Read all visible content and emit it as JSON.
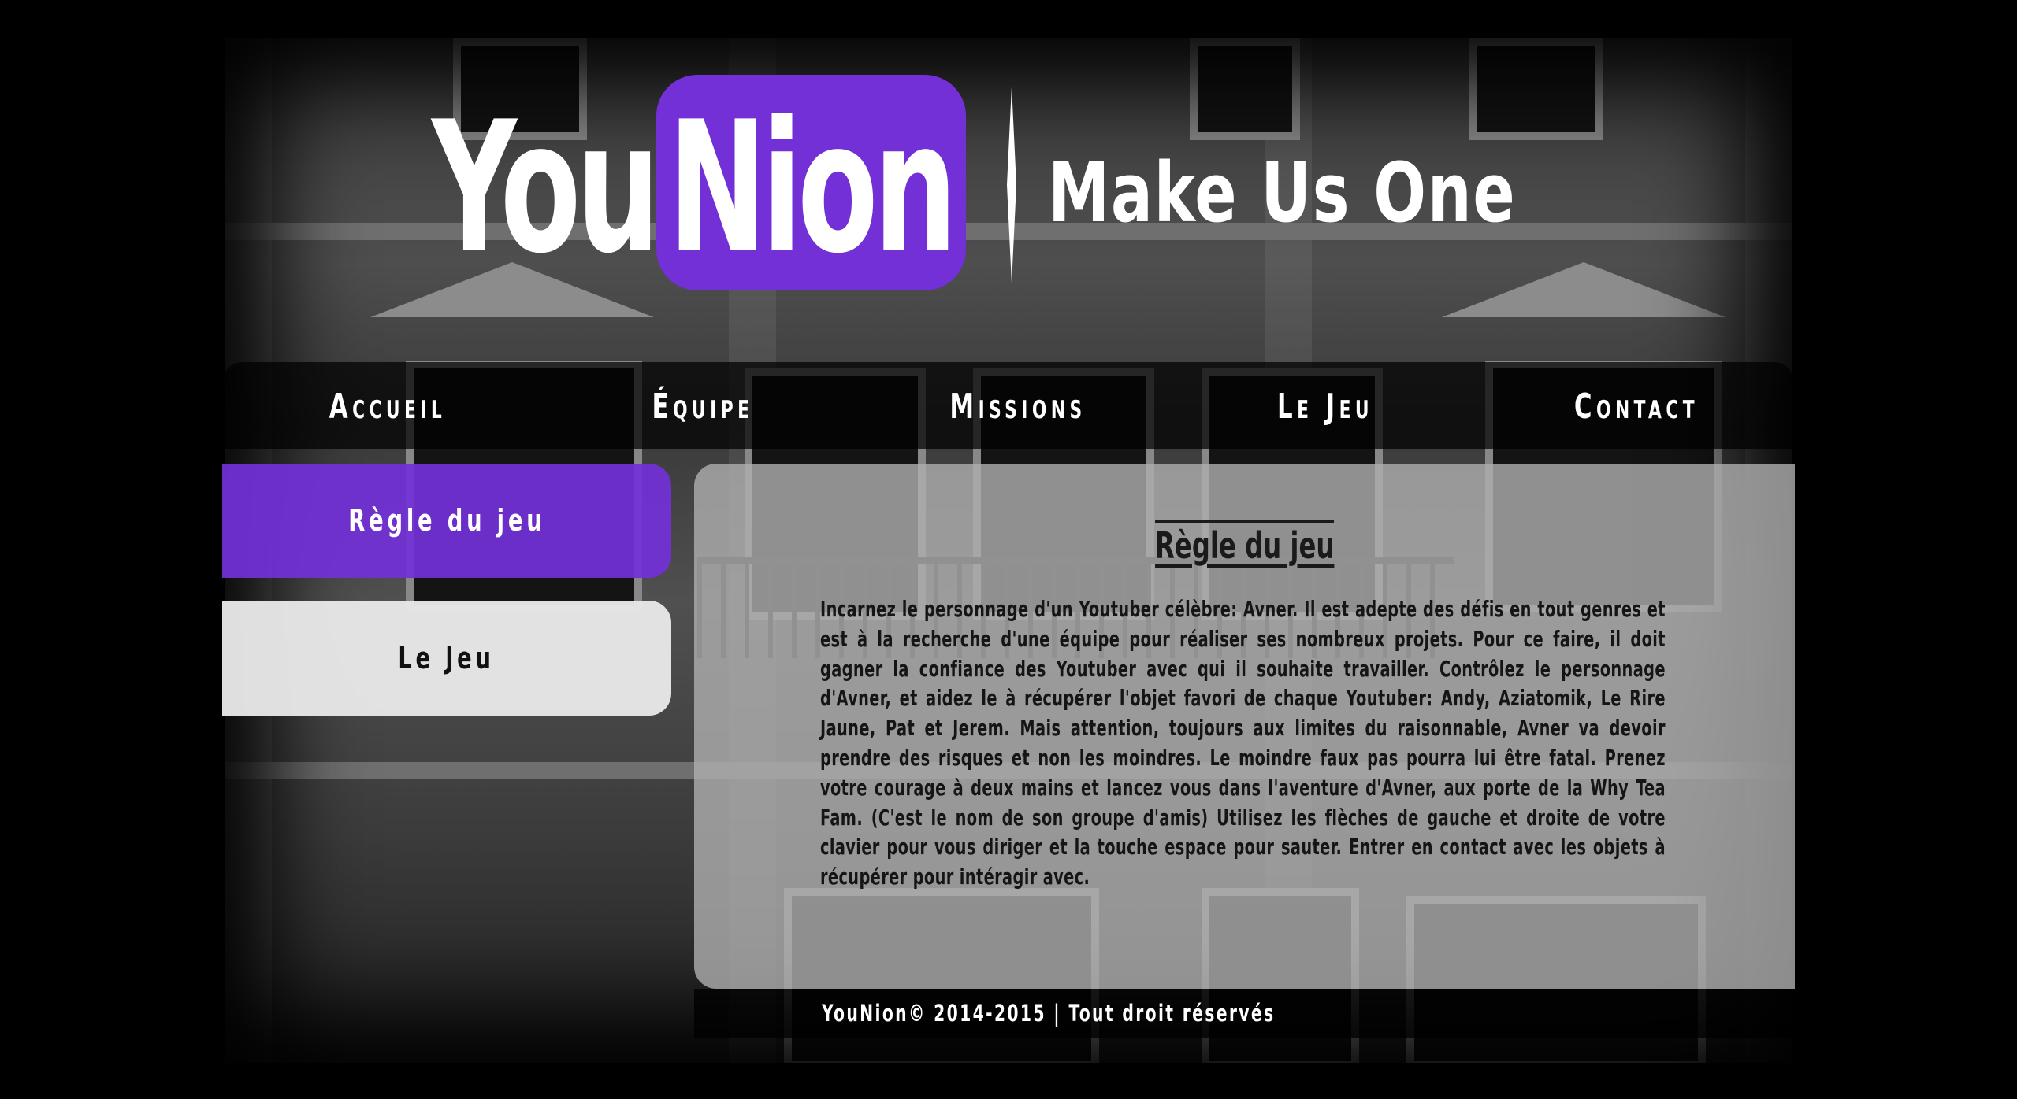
{
  "header": {
    "logo_part1": "You",
    "logo_part2": "Nion",
    "tagline": "Make Us One"
  },
  "nav": {
    "items": [
      {
        "label": "Accueil"
      },
      {
        "label": "Équipe"
      },
      {
        "label": "Missions"
      },
      {
        "label": "Le Jeu"
      },
      {
        "label": "Contact"
      }
    ]
  },
  "sidebar": {
    "items": [
      {
        "label": "Règle du jeu",
        "active": true
      },
      {
        "label": "Le Jeu",
        "active": false
      }
    ]
  },
  "content": {
    "title": "Règle du jeu",
    "body": "Incarnez le personnage d'un Youtuber célèbre: Avner. Il est adepte des défis en tout genres et est à la recherche d'une équipe pour réaliser ses nombreux projets. Pour ce faire, il doit gagner la confiance des Youtuber avec qui il souhaite travailler. Contrôlez le personnage d'Avner, et aidez le à récupérer l'objet favori de chaque Youtuber: Andy, Aziatomik, Le Rire Jaune, Pat et Jerem. Mais attention, toujours aux limites du raisonnable, Avner va devoir prendre des risques et non les moindres. Le moindre faux pas pourra lui être fatal. Prenez votre courage à deux mains et lancez vous dans l'aventure d'Avner, aux porte de la Why Tea Fam. (C'est le nom de son groupe d'amis) Utilisez les flèches de gauche et droite de votre clavier pour vous diriger et la touche espace pour sauter. Entrer en contact avec les objets à récupérer pour intéragir avec."
  },
  "footer": {
    "text": "YouNion© 2014-2015 | Tout droit réservés"
  },
  "colors": {
    "accent": "#7230d6",
    "background": "#000000",
    "panel": "#afafaf"
  }
}
